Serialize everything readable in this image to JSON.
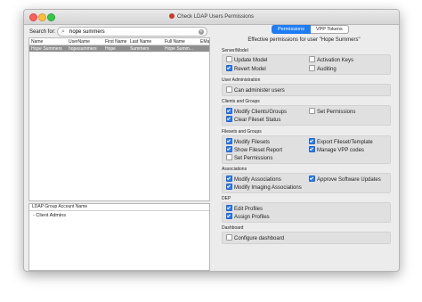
{
  "window": {
    "title": "Check LDAP Users Permissions"
  },
  "search": {
    "label": "Search for:",
    "value": "hope summers"
  },
  "table": {
    "columns": [
      "Name",
      "UserName",
      "First Name",
      "Last Name",
      "Full Name",
      "EMail"
    ],
    "rows": [
      [
        "Hope Summers",
        "hopesummers",
        "Hope",
        "Summers",
        "Hope Summ...",
        ""
      ]
    ]
  },
  "groups": {
    "header": "LDAP Group Account Name",
    "items": [
      "- Client Admins"
    ]
  },
  "tabs": [
    {
      "label": "Permissions",
      "active": true
    },
    {
      "label": "VPP Tokens",
      "active": false
    }
  ],
  "permissions": {
    "heading": "Effective permissions for user \"Hope Summers\"",
    "sections": [
      {
        "title": "Server/Model",
        "items": [
          {
            "label": "Update Model",
            "checked": false
          },
          {
            "label": "Activation Keys",
            "checked": false
          },
          {
            "label": "Revert Model",
            "checked": true
          },
          {
            "label": "Auditing",
            "checked": false
          }
        ]
      },
      {
        "title": "User Administration",
        "items": [
          {
            "label": "Can administer users",
            "checked": false
          }
        ]
      },
      {
        "title": "Clients and Groups",
        "items": [
          {
            "label": "Modify Clients/Groups",
            "checked": true
          },
          {
            "label": "Set Permissions",
            "checked": false
          },
          {
            "label": "Clear Fileset Status",
            "checked": true
          }
        ]
      },
      {
        "title": "Filesets and Groups",
        "items": [
          {
            "label": "Modify Filesets",
            "checked": true
          },
          {
            "label": "Export Fileset/Template",
            "checked": true
          },
          {
            "label": "Show Fileset Report",
            "checked": true
          },
          {
            "label": "Manage VPP codes",
            "checked": true
          },
          {
            "label": "Set Permissions",
            "checked": false
          }
        ]
      },
      {
        "title": "Associations",
        "items": [
          {
            "label": "Modify Associations",
            "checked": true
          },
          {
            "label": "Approve Software Updates",
            "checked": true
          },
          {
            "label": "Modify Imaging Associations",
            "checked": true
          }
        ]
      },
      {
        "title": "DEP",
        "items": [
          {
            "label": "Edit Profiles",
            "checked": true
          },
          {
            "label": "Assign Profiles",
            "checked": true
          }
        ]
      },
      {
        "title": "Dashboard",
        "items": [
          {
            "label": "Configure dashboard",
            "checked": false
          }
        ]
      }
    ]
  },
  "colors": {
    "accent": "#2f7ff2",
    "selection_row": "#8f8f8f",
    "window_bg": "#ececec",
    "section_bg": "#e0e0e0"
  }
}
